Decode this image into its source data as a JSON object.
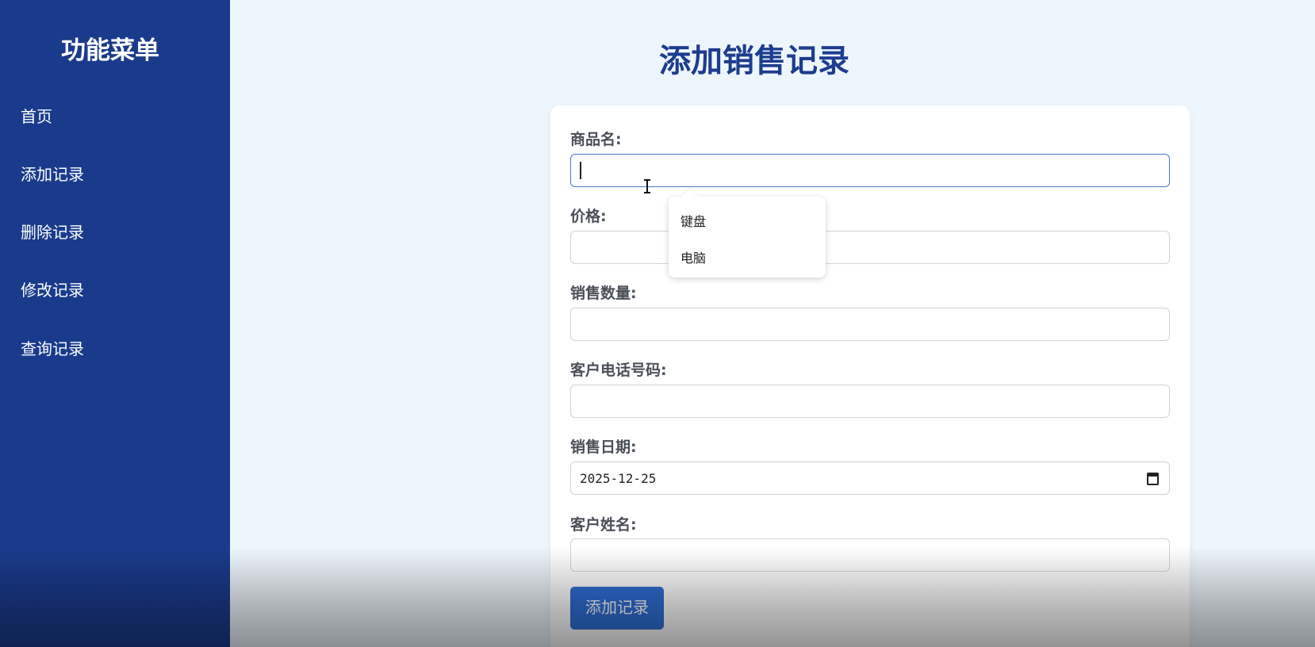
{
  "sidebar": {
    "title": "功能菜单",
    "items": [
      {
        "label": "首页"
      },
      {
        "label": "添加记录"
      },
      {
        "label": "删除记录"
      },
      {
        "label": "修改记录"
      },
      {
        "label": "查询记录"
      }
    ]
  },
  "main": {
    "title": "添加销售记录",
    "form": {
      "product_name": {
        "label": "商品名:",
        "value": ""
      },
      "price": {
        "label": "价格:",
        "value": ""
      },
      "quantity": {
        "label": "销售数量:",
        "value": ""
      },
      "phone": {
        "label": "客户电话号码:",
        "value": ""
      },
      "date": {
        "label": "销售日期:",
        "value": "2025-12-25"
      },
      "customer_name": {
        "label": "客户姓名:",
        "value": ""
      },
      "submit_label": "添加记录"
    },
    "suggestions": [
      {
        "label": "键盘"
      },
      {
        "label": "电脑"
      }
    ]
  },
  "colors": {
    "sidebar_bg": "#1a3b8c",
    "page_bg": "#eef6fd",
    "title": "#1c3d8f",
    "button": "#2f6fd6"
  }
}
